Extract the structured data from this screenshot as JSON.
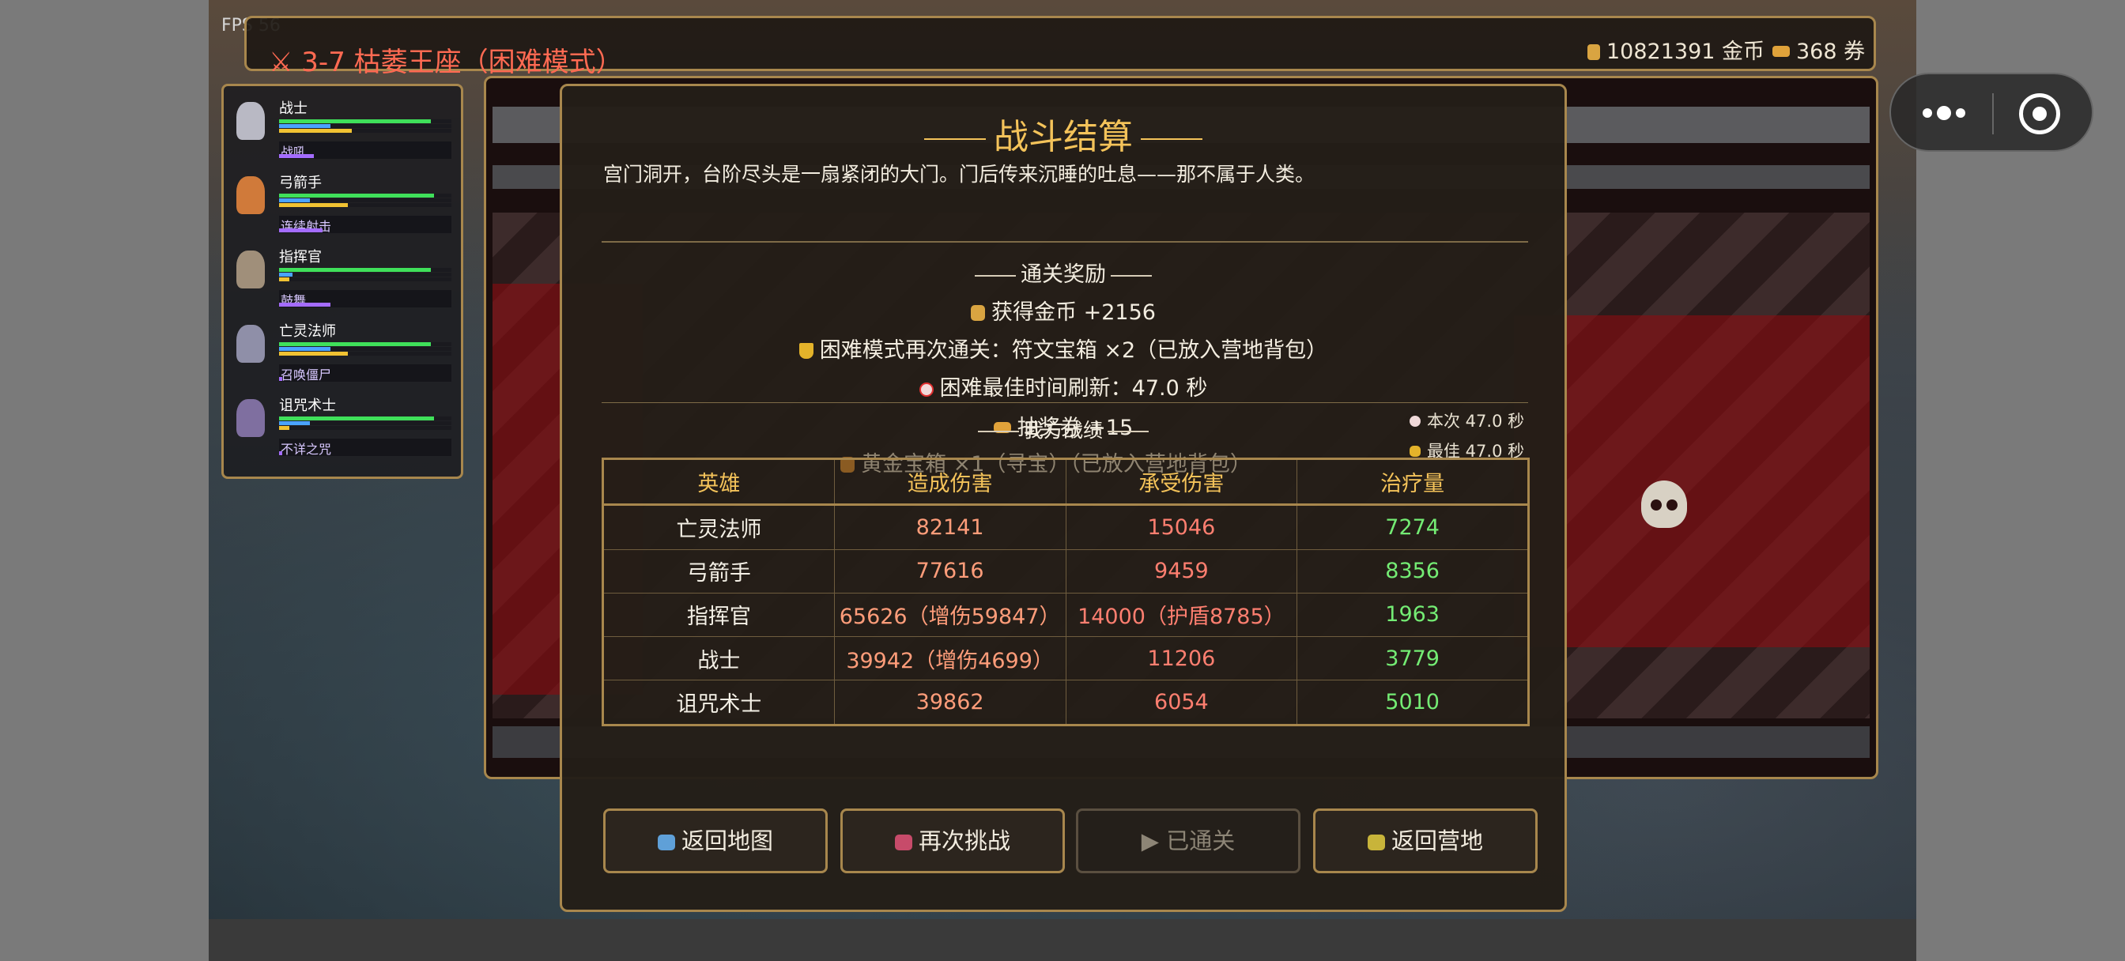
{
  "fps": "FPS 56",
  "topbar": {
    "stage_title": "⚔ 3-7 枯萎王座（困难模式）",
    "gold": "10821391 金币",
    "tickets": "368 券"
  },
  "roster": [
    {
      "name": "战士",
      "skill": "战吼",
      "hp": 0.88,
      "mp": 0.3,
      "xp": 0.42,
      "skill_cd": 0.2
    },
    {
      "name": "弓箭手",
      "skill": "连续射击",
      "hp": 0.9,
      "mp": 0.18,
      "xp": 0.4,
      "skill_cd": 0.25
    },
    {
      "name": "指挥官",
      "skill": "鼓舞",
      "hp": 0.88,
      "mp": 0.08,
      "xp": 0.06,
      "skill_cd": 0.3
    },
    {
      "name": "亡灵法师",
      "skill": "召唤僵尸",
      "hp": 0.88,
      "mp": 0.3,
      "xp": 0.4,
      "skill_cd": 0.01
    },
    {
      "name": "诅咒术士",
      "skill": "不详之咒",
      "hp": 0.9,
      "mp": 0.18,
      "xp": 0.06,
      "skill_cd": 0.01
    }
  ],
  "colors": {
    "hp": "#3fe05a",
    "mp": "#4aa3ff",
    "xp": "#f1c232",
    "skill": "#a46cff",
    "accent": "#a8874d",
    "gold_text": "#f4c35a"
  },
  "dialog": {
    "title": "战斗结算",
    "description": "宫门洞开，台阶尽头是一扇紧闭的大门。门后传来沉睡的吐息——那不属于人类。",
    "rewards_header": "通关奖励",
    "reward_gold": "获得金币 +2156",
    "reward_hard_clear": "困难模式再次通关：符文宝箱 ×2（已放入营地背包）",
    "reward_best_time": "困难最佳时间刷新：47.0 秒",
    "reward_ticket": "抽奖券 +15",
    "reward_chest": "黄金宝箱 ×1（寻宝）（已放入营地背包）",
    "time_current": "本次 47.0 秒",
    "time_best": "最佳 47.0 秒",
    "stats_header": "我方战绩",
    "table": {
      "headers": [
        "英雄",
        "造成伤害",
        "承受伤害",
        "治疗量"
      ],
      "rows": [
        [
          "亡灵法师",
          "82141",
          "15046",
          "7274"
        ],
        [
          "弓箭手",
          "77616",
          "9459",
          "8356"
        ],
        [
          "指挥官",
          "65626（增伤59847）",
          "14000（护盾8785）",
          "1963"
        ],
        [
          "战士",
          "39942（增伤4699）",
          "11206",
          "3779"
        ],
        [
          "诅咒术士",
          "39862",
          "6054",
          "5010"
        ]
      ]
    },
    "buttons": {
      "back_map": "返回地图",
      "retry": "再次挑战",
      "cleared": "▶ 已通关",
      "back_camp": "返回营地"
    }
  }
}
